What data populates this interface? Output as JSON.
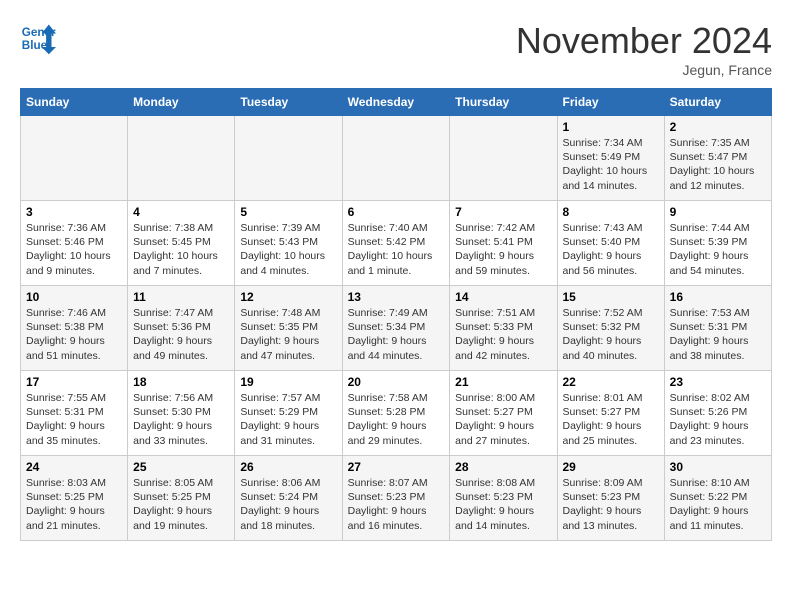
{
  "header": {
    "logo_line1": "General",
    "logo_line2": "Blue",
    "month": "November 2024",
    "location": "Jegun, France"
  },
  "days_of_week": [
    "Sunday",
    "Monday",
    "Tuesday",
    "Wednesday",
    "Thursday",
    "Friday",
    "Saturday"
  ],
  "weeks": [
    [
      {
        "day": "",
        "detail": ""
      },
      {
        "day": "",
        "detail": ""
      },
      {
        "day": "",
        "detail": ""
      },
      {
        "day": "",
        "detail": ""
      },
      {
        "day": "",
        "detail": ""
      },
      {
        "day": "1",
        "detail": "Sunrise: 7:34 AM\nSunset: 5:49 PM\nDaylight: 10 hours and 14 minutes."
      },
      {
        "day": "2",
        "detail": "Sunrise: 7:35 AM\nSunset: 5:47 PM\nDaylight: 10 hours and 12 minutes."
      }
    ],
    [
      {
        "day": "3",
        "detail": "Sunrise: 7:36 AM\nSunset: 5:46 PM\nDaylight: 10 hours and 9 minutes."
      },
      {
        "day": "4",
        "detail": "Sunrise: 7:38 AM\nSunset: 5:45 PM\nDaylight: 10 hours and 7 minutes."
      },
      {
        "day": "5",
        "detail": "Sunrise: 7:39 AM\nSunset: 5:43 PM\nDaylight: 10 hours and 4 minutes."
      },
      {
        "day": "6",
        "detail": "Sunrise: 7:40 AM\nSunset: 5:42 PM\nDaylight: 10 hours and 1 minute."
      },
      {
        "day": "7",
        "detail": "Sunrise: 7:42 AM\nSunset: 5:41 PM\nDaylight: 9 hours and 59 minutes."
      },
      {
        "day": "8",
        "detail": "Sunrise: 7:43 AM\nSunset: 5:40 PM\nDaylight: 9 hours and 56 minutes."
      },
      {
        "day": "9",
        "detail": "Sunrise: 7:44 AM\nSunset: 5:39 PM\nDaylight: 9 hours and 54 minutes."
      }
    ],
    [
      {
        "day": "10",
        "detail": "Sunrise: 7:46 AM\nSunset: 5:38 PM\nDaylight: 9 hours and 51 minutes."
      },
      {
        "day": "11",
        "detail": "Sunrise: 7:47 AM\nSunset: 5:36 PM\nDaylight: 9 hours and 49 minutes."
      },
      {
        "day": "12",
        "detail": "Sunrise: 7:48 AM\nSunset: 5:35 PM\nDaylight: 9 hours and 47 minutes."
      },
      {
        "day": "13",
        "detail": "Sunrise: 7:49 AM\nSunset: 5:34 PM\nDaylight: 9 hours and 44 minutes."
      },
      {
        "day": "14",
        "detail": "Sunrise: 7:51 AM\nSunset: 5:33 PM\nDaylight: 9 hours and 42 minutes."
      },
      {
        "day": "15",
        "detail": "Sunrise: 7:52 AM\nSunset: 5:32 PM\nDaylight: 9 hours and 40 minutes."
      },
      {
        "day": "16",
        "detail": "Sunrise: 7:53 AM\nSunset: 5:31 PM\nDaylight: 9 hours and 38 minutes."
      }
    ],
    [
      {
        "day": "17",
        "detail": "Sunrise: 7:55 AM\nSunset: 5:31 PM\nDaylight: 9 hours and 35 minutes."
      },
      {
        "day": "18",
        "detail": "Sunrise: 7:56 AM\nSunset: 5:30 PM\nDaylight: 9 hours and 33 minutes."
      },
      {
        "day": "19",
        "detail": "Sunrise: 7:57 AM\nSunset: 5:29 PM\nDaylight: 9 hours and 31 minutes."
      },
      {
        "day": "20",
        "detail": "Sunrise: 7:58 AM\nSunset: 5:28 PM\nDaylight: 9 hours and 29 minutes."
      },
      {
        "day": "21",
        "detail": "Sunrise: 8:00 AM\nSunset: 5:27 PM\nDaylight: 9 hours and 27 minutes."
      },
      {
        "day": "22",
        "detail": "Sunrise: 8:01 AM\nSunset: 5:27 PM\nDaylight: 9 hours and 25 minutes."
      },
      {
        "day": "23",
        "detail": "Sunrise: 8:02 AM\nSunset: 5:26 PM\nDaylight: 9 hours and 23 minutes."
      }
    ],
    [
      {
        "day": "24",
        "detail": "Sunrise: 8:03 AM\nSunset: 5:25 PM\nDaylight: 9 hours and 21 minutes."
      },
      {
        "day": "25",
        "detail": "Sunrise: 8:05 AM\nSunset: 5:25 PM\nDaylight: 9 hours and 19 minutes."
      },
      {
        "day": "26",
        "detail": "Sunrise: 8:06 AM\nSunset: 5:24 PM\nDaylight: 9 hours and 18 minutes."
      },
      {
        "day": "27",
        "detail": "Sunrise: 8:07 AM\nSunset: 5:23 PM\nDaylight: 9 hours and 16 minutes."
      },
      {
        "day": "28",
        "detail": "Sunrise: 8:08 AM\nSunset: 5:23 PM\nDaylight: 9 hours and 14 minutes."
      },
      {
        "day": "29",
        "detail": "Sunrise: 8:09 AM\nSunset: 5:23 PM\nDaylight: 9 hours and 13 minutes."
      },
      {
        "day": "30",
        "detail": "Sunrise: 8:10 AM\nSunset: 5:22 PM\nDaylight: 9 hours and 11 minutes."
      }
    ]
  ]
}
